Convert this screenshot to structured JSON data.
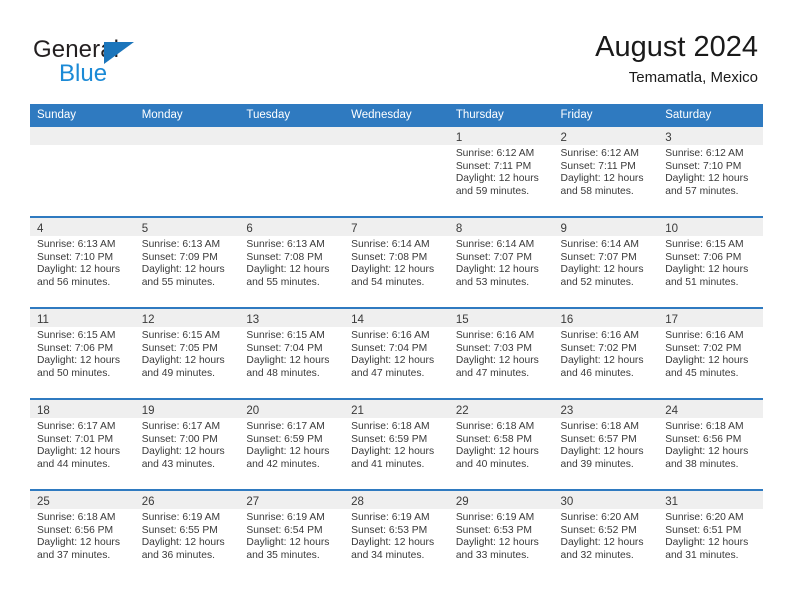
{
  "brand": {
    "name_part1": "General",
    "name_part2": "Blue",
    "logo_icon": "triangle-logo-icon"
  },
  "header": {
    "title": "August 2024",
    "subtitle": "Temamatla, Mexico"
  },
  "colors": {
    "header_blue": "#2f7ac0",
    "brand_blue": "#1b8ad6",
    "logo_blue": "#1b75bb",
    "daynum_band": "#efefef",
    "text": "#3a3a3a"
  },
  "weekdays": [
    "Sunday",
    "Monday",
    "Tuesday",
    "Wednesday",
    "Thursday",
    "Friday",
    "Saturday"
  ],
  "labels": {
    "sunrise": "Sunrise:",
    "sunset": "Sunset:",
    "daylight": "Daylight:"
  },
  "weeks": [
    [
      {
        "day": "",
        "empty": true
      },
      {
        "day": "",
        "empty": true
      },
      {
        "day": "",
        "empty": true
      },
      {
        "day": "",
        "empty": true
      },
      {
        "day": "1",
        "sunrise": "Sunrise: 6:12 AM",
        "sunset": "Sunset: 7:11 PM",
        "daylight": "Daylight: 12 hours and 59 minutes."
      },
      {
        "day": "2",
        "sunrise": "Sunrise: 6:12 AM",
        "sunset": "Sunset: 7:11 PM",
        "daylight": "Daylight: 12 hours and 58 minutes."
      },
      {
        "day": "3",
        "sunrise": "Sunrise: 6:12 AM",
        "sunset": "Sunset: 7:10 PM",
        "daylight": "Daylight: 12 hours and 57 minutes."
      }
    ],
    [
      {
        "day": "4",
        "sunrise": "Sunrise: 6:13 AM",
        "sunset": "Sunset: 7:10 PM",
        "daylight": "Daylight: 12 hours and 56 minutes."
      },
      {
        "day": "5",
        "sunrise": "Sunrise: 6:13 AM",
        "sunset": "Sunset: 7:09 PM",
        "daylight": "Daylight: 12 hours and 55 minutes."
      },
      {
        "day": "6",
        "sunrise": "Sunrise: 6:13 AM",
        "sunset": "Sunset: 7:08 PM",
        "daylight": "Daylight: 12 hours and 55 minutes."
      },
      {
        "day": "7",
        "sunrise": "Sunrise: 6:14 AM",
        "sunset": "Sunset: 7:08 PM",
        "daylight": "Daylight: 12 hours and 54 minutes."
      },
      {
        "day": "8",
        "sunrise": "Sunrise: 6:14 AM",
        "sunset": "Sunset: 7:07 PM",
        "daylight": "Daylight: 12 hours and 53 minutes."
      },
      {
        "day": "9",
        "sunrise": "Sunrise: 6:14 AM",
        "sunset": "Sunset: 7:07 PM",
        "daylight": "Daylight: 12 hours and 52 minutes."
      },
      {
        "day": "10",
        "sunrise": "Sunrise: 6:15 AM",
        "sunset": "Sunset: 7:06 PM",
        "daylight": "Daylight: 12 hours and 51 minutes."
      }
    ],
    [
      {
        "day": "11",
        "sunrise": "Sunrise: 6:15 AM",
        "sunset": "Sunset: 7:06 PM",
        "daylight": "Daylight: 12 hours and 50 minutes."
      },
      {
        "day": "12",
        "sunrise": "Sunrise: 6:15 AM",
        "sunset": "Sunset: 7:05 PM",
        "daylight": "Daylight: 12 hours and 49 minutes."
      },
      {
        "day": "13",
        "sunrise": "Sunrise: 6:15 AM",
        "sunset": "Sunset: 7:04 PM",
        "daylight": "Daylight: 12 hours and 48 minutes."
      },
      {
        "day": "14",
        "sunrise": "Sunrise: 6:16 AM",
        "sunset": "Sunset: 7:04 PM",
        "daylight": "Daylight: 12 hours and 47 minutes."
      },
      {
        "day": "15",
        "sunrise": "Sunrise: 6:16 AM",
        "sunset": "Sunset: 7:03 PM",
        "daylight": "Daylight: 12 hours and 47 minutes."
      },
      {
        "day": "16",
        "sunrise": "Sunrise: 6:16 AM",
        "sunset": "Sunset: 7:02 PM",
        "daylight": "Daylight: 12 hours and 46 minutes."
      },
      {
        "day": "17",
        "sunrise": "Sunrise: 6:16 AM",
        "sunset": "Sunset: 7:02 PM",
        "daylight": "Daylight: 12 hours and 45 minutes."
      }
    ],
    [
      {
        "day": "18",
        "sunrise": "Sunrise: 6:17 AM",
        "sunset": "Sunset: 7:01 PM",
        "daylight": "Daylight: 12 hours and 44 minutes."
      },
      {
        "day": "19",
        "sunrise": "Sunrise: 6:17 AM",
        "sunset": "Sunset: 7:00 PM",
        "daylight": "Daylight: 12 hours and 43 minutes."
      },
      {
        "day": "20",
        "sunrise": "Sunrise: 6:17 AM",
        "sunset": "Sunset: 6:59 PM",
        "daylight": "Daylight: 12 hours and 42 minutes."
      },
      {
        "day": "21",
        "sunrise": "Sunrise: 6:18 AM",
        "sunset": "Sunset: 6:59 PM",
        "daylight": "Daylight: 12 hours and 41 minutes."
      },
      {
        "day": "22",
        "sunrise": "Sunrise: 6:18 AM",
        "sunset": "Sunset: 6:58 PM",
        "daylight": "Daylight: 12 hours and 40 minutes."
      },
      {
        "day": "23",
        "sunrise": "Sunrise: 6:18 AM",
        "sunset": "Sunset: 6:57 PM",
        "daylight": "Daylight: 12 hours and 39 minutes."
      },
      {
        "day": "24",
        "sunrise": "Sunrise: 6:18 AM",
        "sunset": "Sunset: 6:56 PM",
        "daylight": "Daylight: 12 hours and 38 minutes."
      }
    ],
    [
      {
        "day": "25",
        "sunrise": "Sunrise: 6:18 AM",
        "sunset": "Sunset: 6:56 PM",
        "daylight": "Daylight: 12 hours and 37 minutes."
      },
      {
        "day": "26",
        "sunrise": "Sunrise: 6:19 AM",
        "sunset": "Sunset: 6:55 PM",
        "daylight": "Daylight: 12 hours and 36 minutes."
      },
      {
        "day": "27",
        "sunrise": "Sunrise: 6:19 AM",
        "sunset": "Sunset: 6:54 PM",
        "daylight": "Daylight: 12 hours and 35 minutes."
      },
      {
        "day": "28",
        "sunrise": "Sunrise: 6:19 AM",
        "sunset": "Sunset: 6:53 PM",
        "daylight": "Daylight: 12 hours and 34 minutes."
      },
      {
        "day": "29",
        "sunrise": "Sunrise: 6:19 AM",
        "sunset": "Sunset: 6:53 PM",
        "daylight": "Daylight: 12 hours and 33 minutes."
      },
      {
        "day": "30",
        "sunrise": "Sunrise: 6:20 AM",
        "sunset": "Sunset: 6:52 PM",
        "daylight": "Daylight: 12 hours and 32 minutes."
      },
      {
        "day": "31",
        "sunrise": "Sunrise: 6:20 AM",
        "sunset": "Sunset: 6:51 PM",
        "daylight": "Daylight: 12 hours and 31 minutes."
      }
    ]
  ]
}
